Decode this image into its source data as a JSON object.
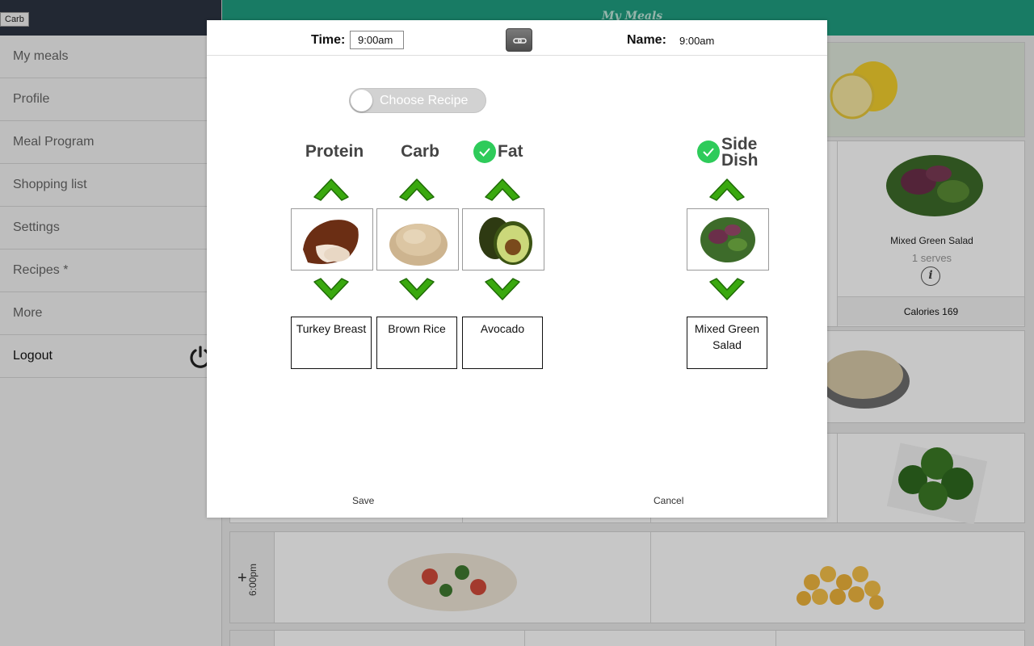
{
  "tooltip": "Carb",
  "app": {
    "title": "My Meals"
  },
  "sidebar": {
    "items": [
      {
        "label": "My meals"
      },
      {
        "label": "Profile"
      },
      {
        "label": "Meal Program"
      },
      {
        "label": "Shopping list"
      },
      {
        "label": "Settings"
      },
      {
        "label": "Recipes *"
      },
      {
        "label": "More"
      },
      {
        "label": "Logout"
      }
    ]
  },
  "background": {
    "card": {
      "title": "Mixed Green Salad",
      "serves": "1 serves",
      "calories": "Calories 169"
    },
    "row_time": "6:00pm",
    "row_plus": "+"
  },
  "modal": {
    "time_label": "Time:",
    "time_value": "9:00am",
    "name_label": "Name:",
    "name_value": "9:00am",
    "toggle_label": "Choose Recipe",
    "columns": [
      {
        "header": "Protein",
        "food": "Turkey Breast",
        "checked": false
      },
      {
        "header": "Carb",
        "food": "Brown Rice",
        "checked": false
      },
      {
        "header": "Fat",
        "food": "Avocado",
        "checked": true
      },
      {
        "header": "Side Dish",
        "food": "Mixed Green Salad",
        "checked": true
      }
    ],
    "save_label": "Save",
    "cancel_label": "Cancel"
  },
  "colors": {
    "accent": "#1f9e80",
    "check": "#2ecb5a",
    "chevron": "#35a10d"
  }
}
